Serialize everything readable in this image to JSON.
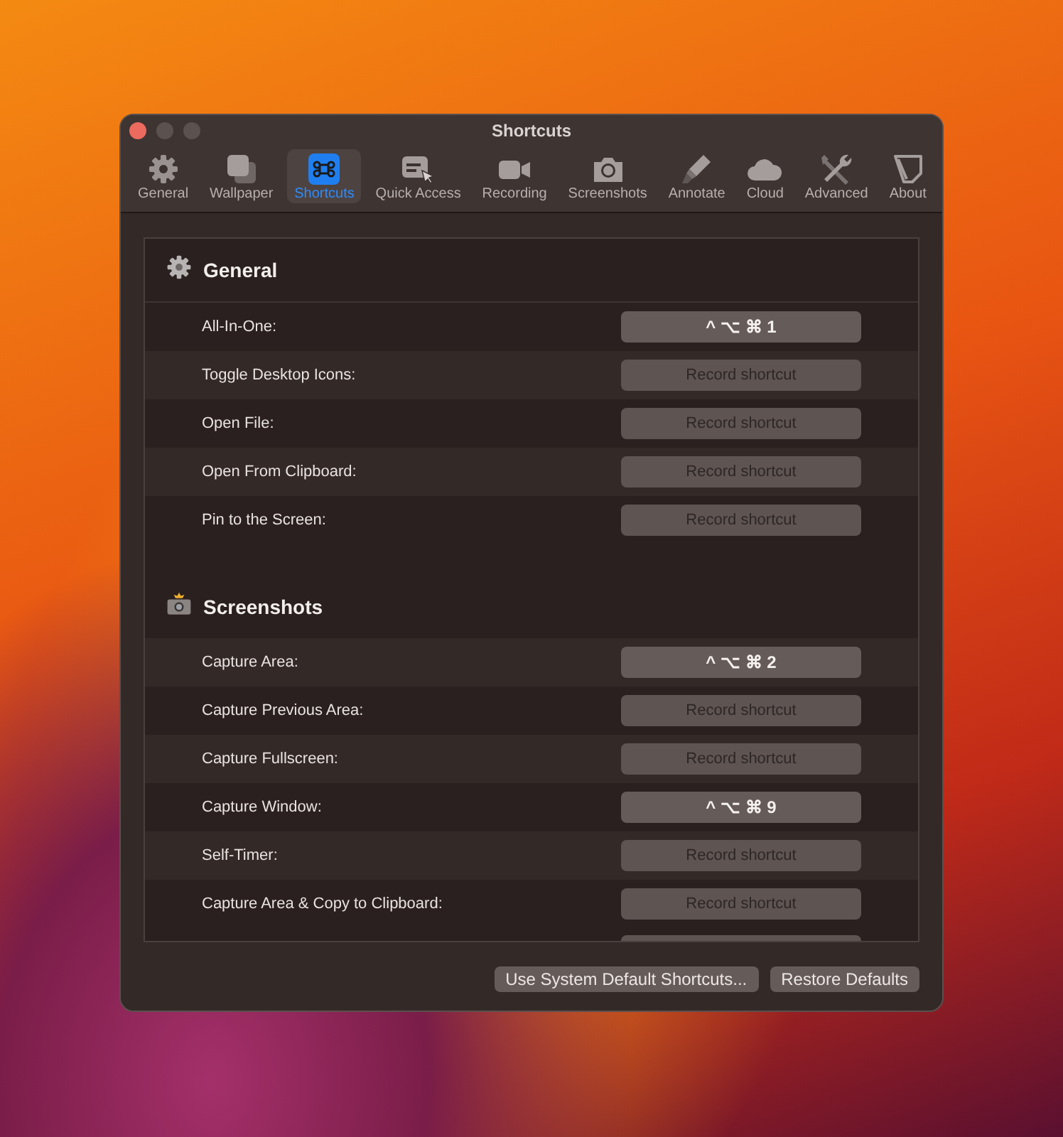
{
  "window": {
    "title": "Shortcuts"
  },
  "tabs": [
    {
      "label": "General",
      "selected": false
    },
    {
      "label": "Wallpaper",
      "selected": false
    },
    {
      "label": "Shortcuts",
      "selected": true
    },
    {
      "label": "Quick Access",
      "selected": false
    },
    {
      "label": "Recording",
      "selected": false
    },
    {
      "label": "Screenshots",
      "selected": false
    },
    {
      "label": "Annotate",
      "selected": false
    },
    {
      "label": "Cloud",
      "selected": false
    },
    {
      "label": "Advanced",
      "selected": false
    },
    {
      "label": "About",
      "selected": false
    }
  ],
  "sections": [
    {
      "title": "General",
      "kind": "gear",
      "rows": [
        {
          "label": "All-In-One:",
          "shortcut": "^ ⌥ ⌘ 1"
        },
        {
          "label": "Toggle Desktop Icons:",
          "placeholder": "Record shortcut"
        },
        {
          "label": "Open File:",
          "placeholder": "Record shortcut"
        },
        {
          "label": "Open From Clipboard:",
          "placeholder": "Record shortcut"
        },
        {
          "label": "Pin to the Screen:",
          "placeholder": "Record shortcut"
        }
      ]
    },
    {
      "title": "Screenshots",
      "kind": "camera",
      "rows": [
        {
          "label": "Capture Area:",
          "shortcut": "^ ⌥ ⌘ 2"
        },
        {
          "label": "Capture Previous Area:",
          "placeholder": "Record shortcut"
        },
        {
          "label": "Capture Fullscreen:",
          "placeholder": "Record shortcut"
        },
        {
          "label": "Capture Window:",
          "shortcut": "^ ⌥ ⌘ 9"
        },
        {
          "label": "Self-Timer:",
          "placeholder": "Record shortcut"
        },
        {
          "label": "Capture Area & Copy to Clipboard:",
          "placeholder": "Record shortcut"
        }
      ]
    }
  ],
  "buttons": [
    {
      "label": "Use System Default Shortcuts..."
    },
    {
      "label": "Restore Defaults"
    }
  ]
}
